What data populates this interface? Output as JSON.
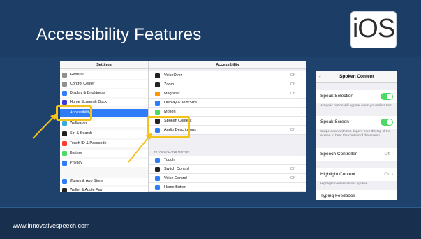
{
  "slide": {
    "title": "Accessibility Features",
    "logo_text": "iOS",
    "footer_url": "www.innovativespeech.com"
  },
  "settings": {
    "left_header": "Settings",
    "right_header": "Accessibility",
    "left_items": [
      {
        "label": "General",
        "color": "#8e8e93",
        "icon": "gear-icon"
      },
      {
        "label": "Control Center",
        "color": "#8e8e93",
        "icon": "control-center-icon"
      },
      {
        "label": "Display & Brightness",
        "color": "#2f7df6",
        "icon": "display-icon"
      },
      {
        "label": "Home Screen & Dock",
        "color": "#3b3bd6",
        "icon": "home-screen-icon"
      },
      {
        "label": "Accessibility",
        "color": "#2f7df6",
        "icon": "accessibility-icon",
        "selected": true
      },
      {
        "label": "Wallpaper",
        "color": "#35aadc",
        "icon": "wallpaper-icon"
      },
      {
        "label": "Siri & Search",
        "color": "#222",
        "icon": "siri-icon"
      },
      {
        "label": "Touch ID & Passcode",
        "color": "#ff3b30",
        "icon": "fingerprint-icon"
      },
      {
        "label": "Battery",
        "color": "#4cd964",
        "icon": "battery-icon"
      },
      {
        "label": "Privacy",
        "color": "#2f7df6",
        "icon": "hand-icon"
      },
      {
        "label": "iTunes & App Store",
        "color": "#2f7df6",
        "icon": "app-store-icon"
      },
      {
        "label": "Wallet & Apple Pay",
        "color": "#222",
        "icon": "wallet-icon"
      }
    ],
    "right_items": [
      {
        "label": "VoiceOver",
        "value": "Off",
        "color": "#222"
      },
      {
        "label": "Zoom",
        "value": "Off",
        "color": "#222"
      },
      {
        "label": "Magnifier",
        "value": "On",
        "color": "#ff9500"
      },
      {
        "label": "Display & Text Size",
        "value": "",
        "color": "#2f7df6"
      },
      {
        "label": "Motion",
        "value": "",
        "color": "#4cd964"
      },
      {
        "label": "Spoken Content",
        "value": "",
        "color": "#222"
      },
      {
        "label": "Audio Descriptions",
        "value": "Off",
        "color": "#2f7df6"
      }
    ],
    "section_label": "PHYSICAL AND MOTOR",
    "motor_items": [
      {
        "label": "Touch",
        "value": "",
        "color": "#2f7df6"
      },
      {
        "label": "Switch Control",
        "value": "Off",
        "color": "#222"
      },
      {
        "label": "Voice Control",
        "value": "Off",
        "color": "#2f7df6"
      },
      {
        "label": "Home Button",
        "value": "",
        "color": "#2f7df6"
      }
    ],
    "chevron": "›"
  },
  "spoken": {
    "back": "‹",
    "title": "Spoken Content",
    "speak_selection": "Speak Selection",
    "speak_selection_note": "A Speak button will appear when you select text.",
    "speak_screen": "Speak Screen",
    "speak_screen_note": "Swipe down with two fingers from the top of the screen to hear the content of the screen.",
    "speech_controller": "Speech Controller",
    "speech_controller_value": "Off",
    "highlight_content": "Highlight Content",
    "highlight_content_value": "On",
    "highlight_note": "Highlight content as it is spoken.",
    "typing_feedback": "Typing Feedback",
    "chevron": "›",
    "toggle_color": "#4cd964"
  },
  "highlight_color": "#f3c21b"
}
